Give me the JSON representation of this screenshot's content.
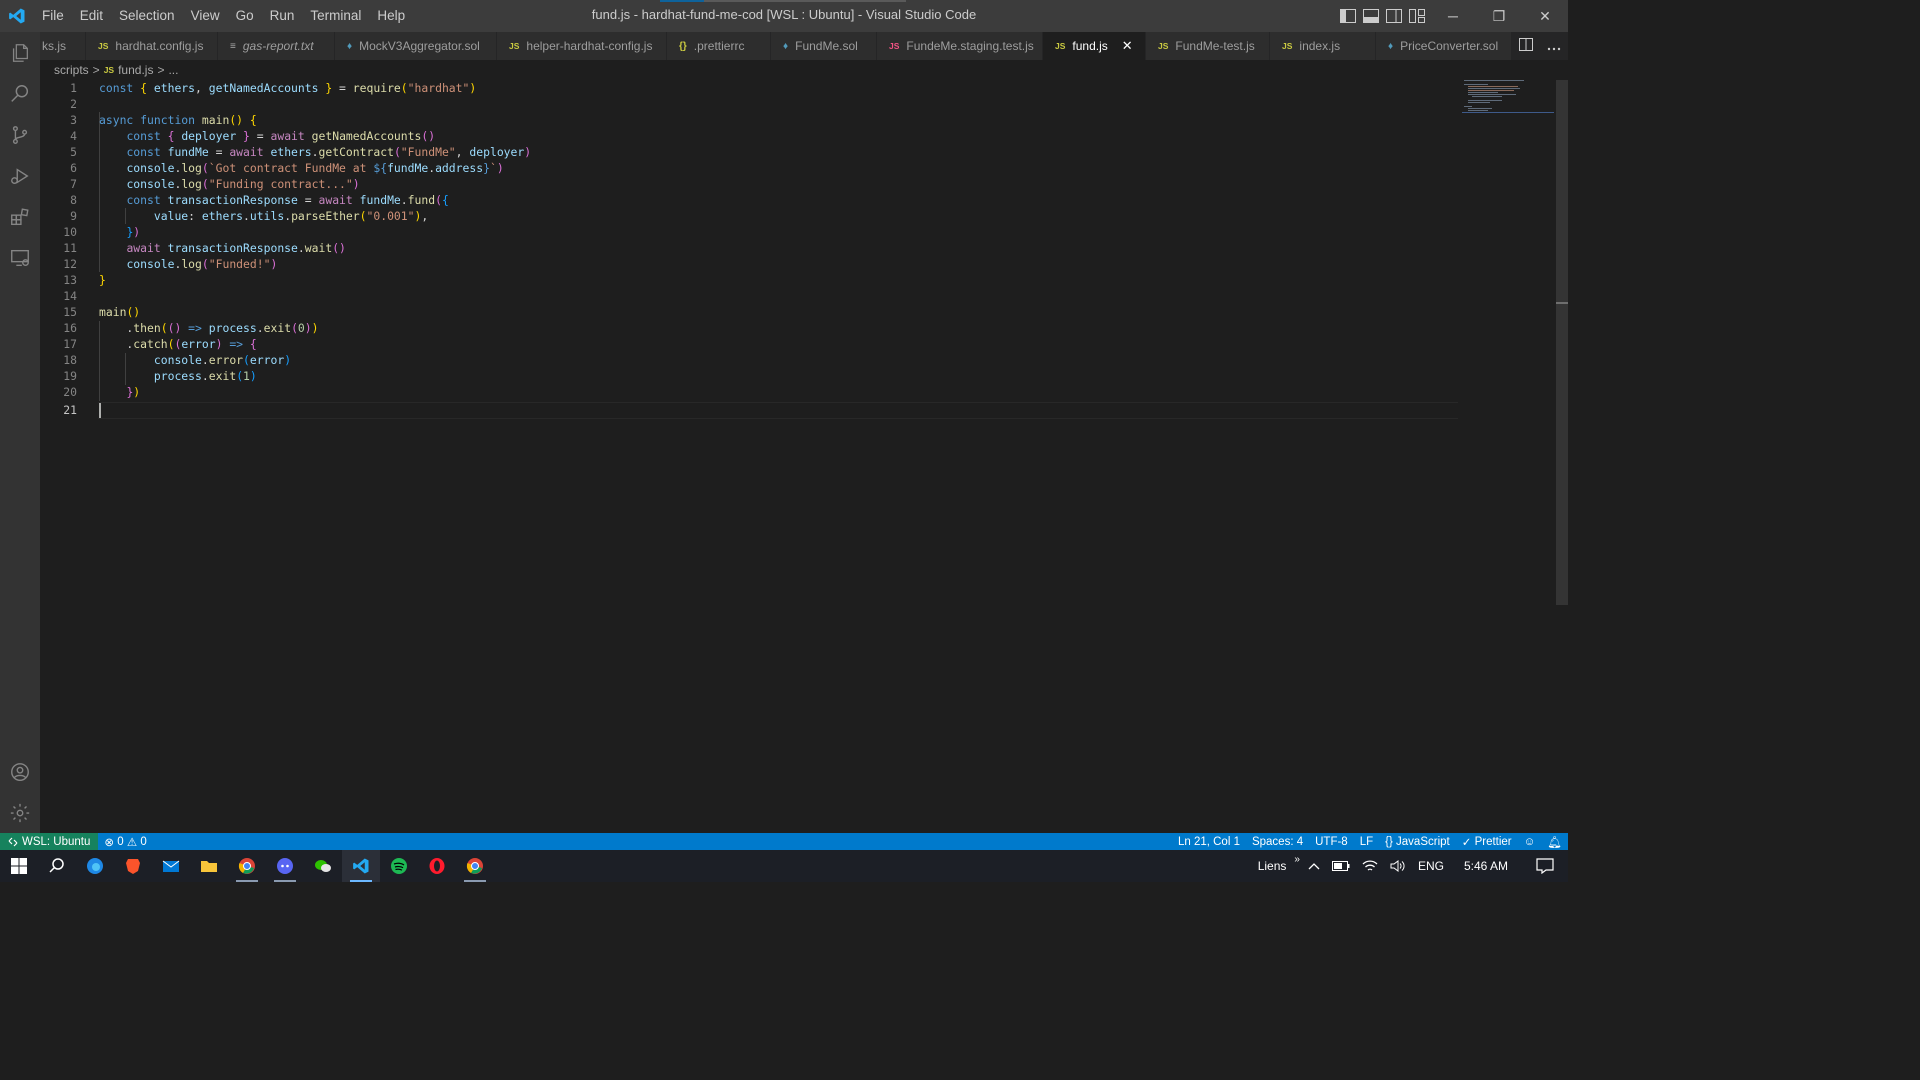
{
  "window": {
    "title": "fund.js - hardhat-fund-me-cod [WSL : Ubuntu] - Visual Studio Code",
    "menu": [
      "File",
      "Edit",
      "Selection",
      "View",
      "Go",
      "Run",
      "Terminal",
      "Help"
    ],
    "minimize": "─",
    "restore": "❐",
    "close": "✕"
  },
  "tabs": [
    {
      "label": "ks.js",
      "icon": "",
      "icon_color": "#cbcb41"
    },
    {
      "label": "hardhat.config.js",
      "icon": "JS",
      "icon_color": "#cbcb41"
    },
    {
      "label": "gas-report.txt",
      "icon": "≡",
      "icon_color": "#a9a9a9"
    },
    {
      "label": "MockV3Aggregator.sol",
      "icon": "♦",
      "icon_color": "#519aba"
    },
    {
      "label": "helper-hardhat-config.js",
      "icon": "JS",
      "icon_color": "#cbcb41"
    },
    {
      "label": ".prettierrc",
      "icon": "{}",
      "icon_color": "#cbcb41"
    },
    {
      "label": "FundMe.sol",
      "icon": "♦",
      "icon_color": "#519aba"
    },
    {
      "label": "FundeMe.staging.test.js",
      "icon": "JS",
      "icon_color": "#f55385"
    },
    {
      "label": "fund.js",
      "icon": "JS",
      "icon_color": "#cbcb41"
    },
    {
      "label": "FundMe-test.js",
      "icon": "JS",
      "icon_color": "#cbcb41"
    },
    {
      "label": "index.js",
      "icon": "JS",
      "icon_color": "#cbcb41"
    },
    {
      "label": "PriceConverter.sol",
      "icon": "♦",
      "icon_color": "#519aba"
    }
  ],
  "active_tab_close": "✕",
  "breadcrumb": {
    "folder": "scripts",
    "file_icon": "JS",
    "file": "fund.js",
    "more": "...",
    "sep": ">"
  },
  "editor": {
    "line_numbers": [
      "1",
      "2",
      "3",
      "4",
      "5",
      "6",
      "7",
      "8",
      "9",
      "10",
      "11",
      "12",
      "13",
      "14",
      "15",
      "16",
      "17",
      "18",
      "19",
      "20",
      "21"
    ],
    "cursor_line": "21"
  },
  "statusbar": {
    "remote": "WSL: Ubuntu",
    "errors": "0",
    "warnings": "0",
    "position": "Ln 21, Col 1",
    "spaces": "Spaces: 4",
    "encoding": "UTF-8",
    "eol": "LF",
    "language": "JavaScript",
    "formatter": "Prettier"
  },
  "taskbar": {
    "tray_label": "Liens",
    "chevron": "»",
    "language": "ENG",
    "time": "5:46 AM"
  },
  "colors": {
    "accent": "#007acc",
    "remote": "#16825d",
    "editor_bg": "#1e1e1e"
  }
}
